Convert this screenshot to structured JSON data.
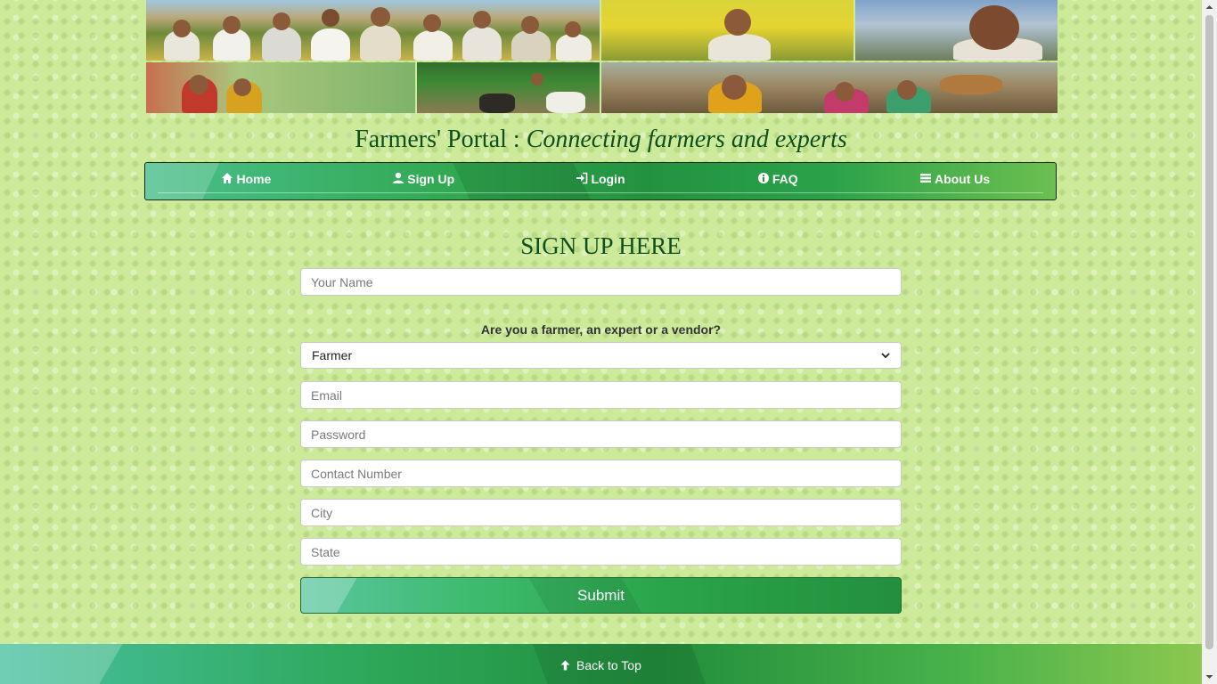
{
  "header": {
    "title": "Farmers' Portal :",
    "tagline": "Connecting farmers and experts",
    "banner_photos": [
      "banner-photo-group-of-farmers",
      "banner-photo-farmer-mustard-field",
      "banner-photo-smiling-farmer",
      "banner-photo-woman-carrying-basket",
      "banner-photo-ox-ploughing",
      "banner-photo-women-farmers"
    ]
  },
  "nav": {
    "items": [
      {
        "label": "Home",
        "icon": "home-icon"
      },
      {
        "label": "Sign Up",
        "icon": "user-icon"
      },
      {
        "label": "Login",
        "icon": "login-icon"
      },
      {
        "label": "FAQ",
        "icon": "info-icon"
      },
      {
        "label": "About Us",
        "icon": "list-icon"
      }
    ]
  },
  "form": {
    "heading": "SIGN UP HERE",
    "name_placeholder": "Your Name",
    "role_question": "Are you a farmer, an expert or a vendor?",
    "role_selected": "Farmer",
    "email_placeholder": "Email",
    "password_placeholder": "Password",
    "contact_placeholder": "Contact Number",
    "city_placeholder": "City",
    "state_placeholder": "State",
    "submit_label": "Submit"
  },
  "footer": {
    "back_to_top": "Back to Top"
  },
  "colors": {
    "page_background": "#cdea9a",
    "heading_green": "#0e4f1f",
    "nav_green": "#23923f"
  }
}
